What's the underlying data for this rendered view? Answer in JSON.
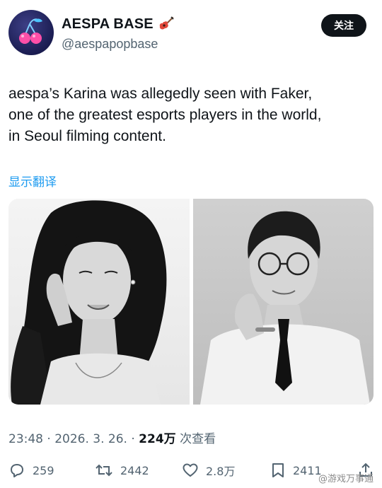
{
  "account": {
    "display_name": "AESPA BASE",
    "handle": "@aespapopbase",
    "name_emoji": "guitar",
    "follow_label": "关注"
  },
  "tweet": {
    "lines": [
      "aespa’s Karina was allegedly seen with Faker,",
      "one of the greatest esports players in the world,",
      "in Seoul filming content."
    ],
    "translate_label": "显示翻译"
  },
  "media": {
    "images": [
      {
        "icon": "portrait-photo-woman"
      },
      {
        "icon": "portrait-photo-man"
      }
    ]
  },
  "meta": {
    "time": "23:48",
    "separator": "·",
    "date": "2026. 3. 26.",
    "views_count": "224万",
    "views_label": "次查看"
  },
  "actions": {
    "reply_count": "259",
    "retweet_count": "2442",
    "like_count": "2.8万",
    "bookmark_count": "2411"
  },
  "watermark": "@游戏万事通",
  "colors": {
    "accent": "#1d9bf0",
    "text": "#0f1419",
    "secondary": "#536471",
    "follow_bg": "#0f1419"
  }
}
